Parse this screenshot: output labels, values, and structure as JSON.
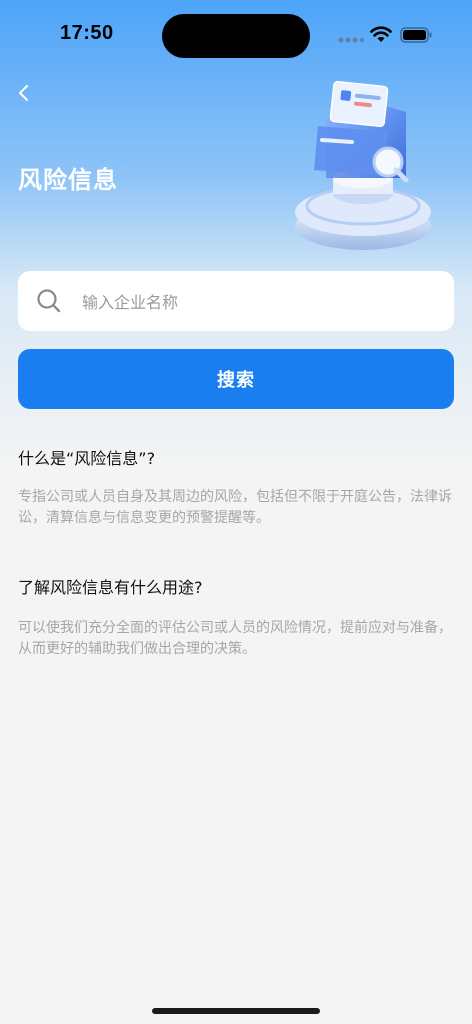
{
  "status_bar": {
    "time": "17:50"
  },
  "header": {
    "title": "风险信息"
  },
  "search": {
    "placeholder": "输入企业名称",
    "value": "",
    "button_label": "搜索"
  },
  "sections": [
    {
      "question": "什么是“风险信息”?",
      "answer": "专指公司或人员自身及其周边的风险，包括但不限于开庭公告，法律诉讼，清算信息与信息变更的预警提醒等。"
    },
    {
      "question": "了解风险信息有什么用途?",
      "answer": "可以使我们充分全面的评估公司或人员的风险情况，提前应对与准备，从而更好的辅助我们做出合理的决策。"
    }
  ],
  "icons": {
    "back": "chevron-left-icon",
    "search": "search-icon",
    "signal": "signal-icon",
    "wifi": "wifi-icon",
    "battery": "battery-icon"
  },
  "colors": {
    "accent": "#1a7ef0",
    "header_gradient_top": "#4da4f9"
  }
}
